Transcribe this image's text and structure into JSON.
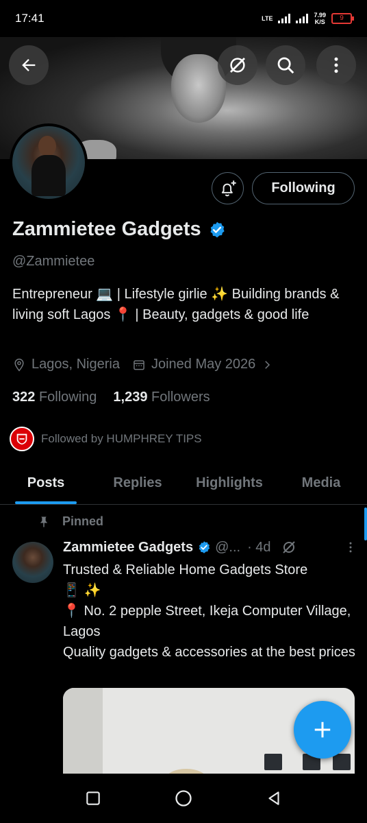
{
  "status_bar": {
    "time": "17:41",
    "network": "LTE",
    "speed_value": "7.99",
    "speed_unit": "K/S",
    "battery": "9"
  },
  "header": {
    "back_icon": "arrow-left-icon",
    "grok_icon": "grok-icon",
    "search_icon": "search-icon",
    "more_icon": "more-vertical-icon"
  },
  "profile": {
    "display_name": "Zammietee Gadgets",
    "handle": "@Zammietee",
    "bio": "Entrepreneur 💻 | Lifestyle girlie ✨ Building brands & living soft Lagos 📍 | Beauty, gadgets & good life",
    "location": "Lagos, Nigeria",
    "joined": "Joined May 2026",
    "following_count": "322",
    "following_label": "Following",
    "followers_count": "1,239",
    "followers_label": "Followers",
    "followed_by": "Followed by HUMPHREY TIPS",
    "follow_button": "Following",
    "verified_color": "#1d9bf0"
  },
  "tabs": [
    {
      "label": "Posts",
      "active": true
    },
    {
      "label": "Replies",
      "active": false
    },
    {
      "label": "Highlights",
      "active": false
    },
    {
      "label": "Media",
      "active": false
    }
  ],
  "pinned_post": {
    "pinned_label": "Pinned",
    "author": "Zammietee Gadgets",
    "handle": "@...",
    "time": "· 4d",
    "lines": [
      "Trusted & Reliable Home Gadgets Store",
      "📱 ✨",
      "📍 No. 2 pepple Street, Ikeja Computer Village, Lagos",
      "Quality gadgets & accessories at the best prices"
    ]
  },
  "colors": {
    "accent": "#1d9bf0",
    "muted": "#71767b",
    "text": "#e7e9ea",
    "background": "#000000"
  }
}
